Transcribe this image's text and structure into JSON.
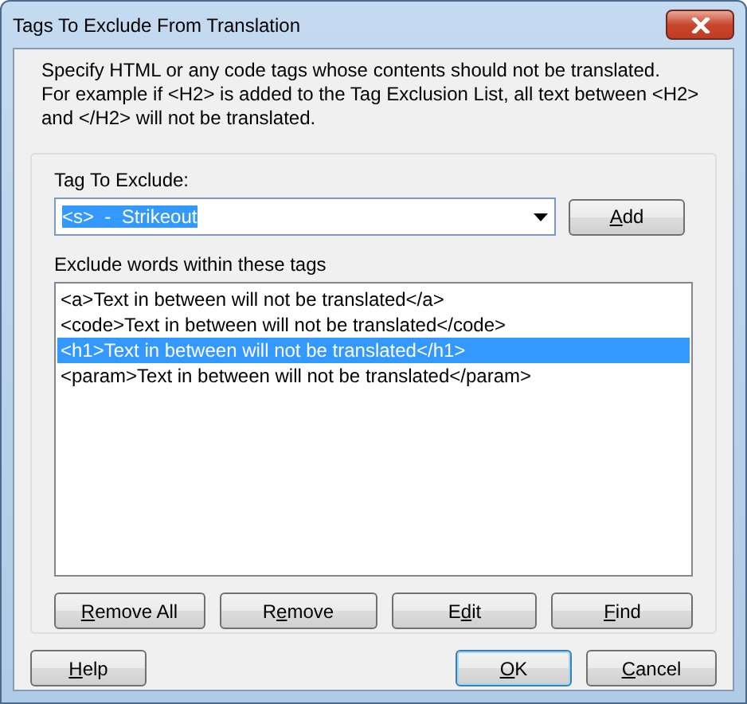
{
  "window": {
    "title": "Tags To Exclude From Translation"
  },
  "description": [
    "Specify HTML or any code tags whose contents should not be translated.",
    "For example if <H2> is added to the Tag Exclusion List, all text between <H2>",
    "and </H2> will not be translated."
  ],
  "tag_field": {
    "label": "Tag To Exclude:",
    "value": "<s>  -  Strikeout",
    "text_selected": true
  },
  "add_button": {
    "label": [
      {
        "text": "A",
        "underline": true
      },
      {
        "text": "dd",
        "underline": false
      }
    ]
  },
  "list": {
    "label": "Exclude words within these tags",
    "items": [
      {
        "text": "<a>Text in between will not be translated</a>",
        "selected": false
      },
      {
        "text": "<code>Text in between will not be translated</code>",
        "selected": false
      },
      {
        "text": "<h1>Text in between will not be translated</h1>",
        "selected": true
      },
      {
        "text": "<param>Text in between will not be translated</param>",
        "selected": false
      }
    ]
  },
  "list_buttons": [
    {
      "label": [
        {
          "text": "R",
          "underline": true
        },
        {
          "text": "emove All",
          "underline": false
        }
      ]
    },
    {
      "label": [
        {
          "text": "R",
          "underline": false
        },
        {
          "text": "e",
          "underline": true
        },
        {
          "text": "move",
          "underline": false
        }
      ]
    },
    {
      "label": [
        {
          "text": "E",
          "underline": false
        },
        {
          "text": "d",
          "underline": true
        },
        {
          "text": "it",
          "underline": false
        }
      ]
    },
    {
      "label": [
        {
          "text": "F",
          "underline": true
        },
        {
          "text": "ind",
          "underline": false
        }
      ]
    }
  ],
  "dialog_buttons": [
    {
      "label": [
        {
          "text": "H",
          "underline": true
        },
        {
          "text": "elp",
          "underline": false
        }
      ],
      "default": false
    },
    {
      "label": [
        {
          "text": "O",
          "underline": true
        },
        {
          "text": "K",
          "underline": false
        }
      ],
      "default": true
    },
    {
      "label": [
        {
          "text": "C",
          "underline": true
        },
        {
          "text": "ancel",
          "underline": false
        }
      ],
      "default": false
    }
  ]
}
